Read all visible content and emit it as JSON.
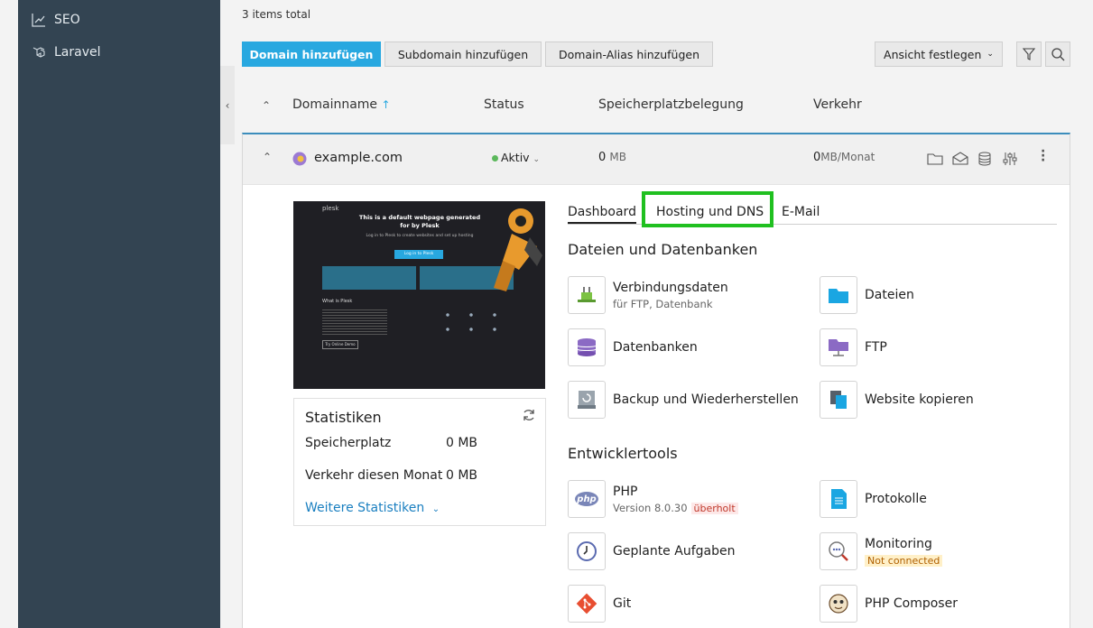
{
  "sidebar": {
    "items": [
      {
        "label": "SEO",
        "icon": "seo-chart-icon"
      },
      {
        "label": "Laravel",
        "icon": "laravel-icon"
      }
    ]
  },
  "list": {
    "items_total": "3 items total",
    "buttons": {
      "add_domain": "Domain hinzufügen",
      "add_subdomain": "Subdomain hinzufügen",
      "add_alias": "Domain-Alias hinzufügen",
      "set_view": "Ansicht festlegen"
    },
    "columns": {
      "domain": "Domainname",
      "status": "Status",
      "storage": "Speicherplatzbelegung",
      "traffic": "Verkehr"
    }
  },
  "domain": {
    "name": "example.com",
    "status": "Aktiv",
    "storage_value": "0",
    "storage_unit": "MB",
    "traffic_value": "0",
    "traffic_unit": "MB/Monat"
  },
  "preview": {
    "brand": "plesk",
    "headline": "This is a default webpage generated for by Plesk",
    "subline": "Log in to Plesk to create websites and set up hosting",
    "login_button": "Log in to Plesk",
    "what_is": "What is Plesk",
    "try_demo": "Try Online Demo"
  },
  "stats": {
    "title": "Statistiken",
    "storage_label": "Speicherplatz",
    "storage_value": "0 MB",
    "traffic_label": "Verkehr diesen Monat",
    "traffic_value": "0 MB",
    "more_link": "Weitere Statistiken"
  },
  "tabs": [
    {
      "label": "Dashboard"
    },
    {
      "label": "Hosting und DNS"
    },
    {
      "label": "E-Mail"
    }
  ],
  "sections": {
    "files_db": "Dateien und Datenbanken",
    "dev_tools": "Entwicklertools"
  },
  "tools": {
    "connection": {
      "label": "Verbindungsdaten",
      "sub": "für FTP, Datenbank"
    },
    "files": {
      "label": "Dateien"
    },
    "databases": {
      "label": "Datenbanken"
    },
    "ftp": {
      "label": "FTP"
    },
    "backup": {
      "label": "Backup und Wiederherstellen"
    },
    "copy_site": {
      "label": "Website kopieren"
    },
    "php": {
      "label": "PHP",
      "sub": "Version 8.0.30",
      "badge": "überholt",
      "icon_text": "php"
    },
    "logs": {
      "label": "Protokolle"
    },
    "scheduled": {
      "label": "Geplante Aufgaben"
    },
    "monitoring": {
      "label": "Monitoring",
      "badge": "Not connected"
    },
    "git": {
      "label": "Git"
    },
    "composer": {
      "label": "PHP Composer"
    }
  },
  "colors": {
    "sidebar_bg": "#334452",
    "primary": "#28a8e0",
    "link": "#1a7fc0",
    "status_active": "#5cb85c",
    "highlight": "#20c020"
  }
}
